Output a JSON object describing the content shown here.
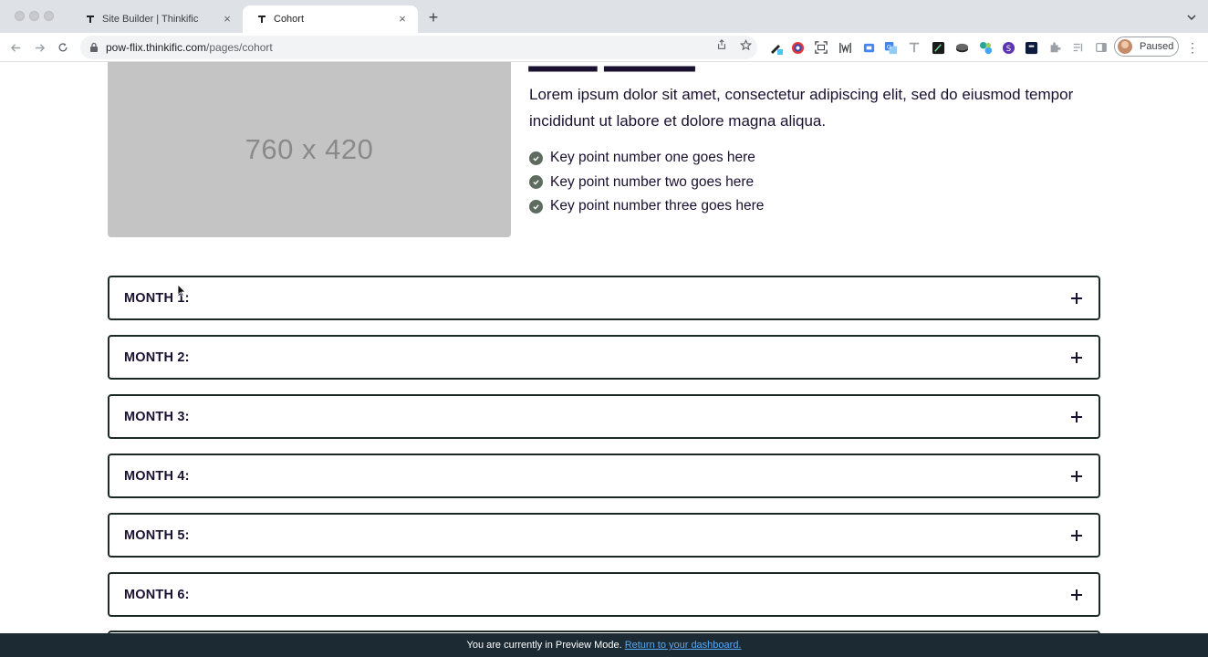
{
  "browser": {
    "tabs": [
      {
        "title": "Site Builder | Thinkific",
        "close": "×"
      },
      {
        "title": "Cohort",
        "close": "×"
      }
    ],
    "new_tab": "+",
    "url_host": "pow-flix.thinkific.com",
    "url_path": "/pages/cohort",
    "profile_status": "Paused",
    "menu": "⋮"
  },
  "section": {
    "image_placeholder": "760 x 420",
    "lead_text": "Lorem ipsum dolor sit amet, consectetur adipiscing elit, sed do eiusmod tempor incididunt ut labore et dolore magna aliqua.",
    "key_points": [
      "Key point number one goes here",
      "Key point number two goes here",
      "Key point number three goes here"
    ]
  },
  "accordion": [
    {
      "title": "MONTH 1:"
    },
    {
      "title": "MONTH 2:"
    },
    {
      "title": "MONTH 3:"
    },
    {
      "title": "MONTH 4:"
    },
    {
      "title": "MONTH 5:"
    },
    {
      "title": "MONTH 6:"
    }
  ],
  "preview_bar": {
    "message": "You are currently in Preview Mode.",
    "link": "Return to your dashboard."
  },
  "colors": {
    "text_dark": "#1a1030",
    "accordion_border": "#1c2a24",
    "preview_bar_bg": "#1c2a33",
    "preview_link": "#5aa8f0",
    "check_bg": "#5e6b5f"
  }
}
